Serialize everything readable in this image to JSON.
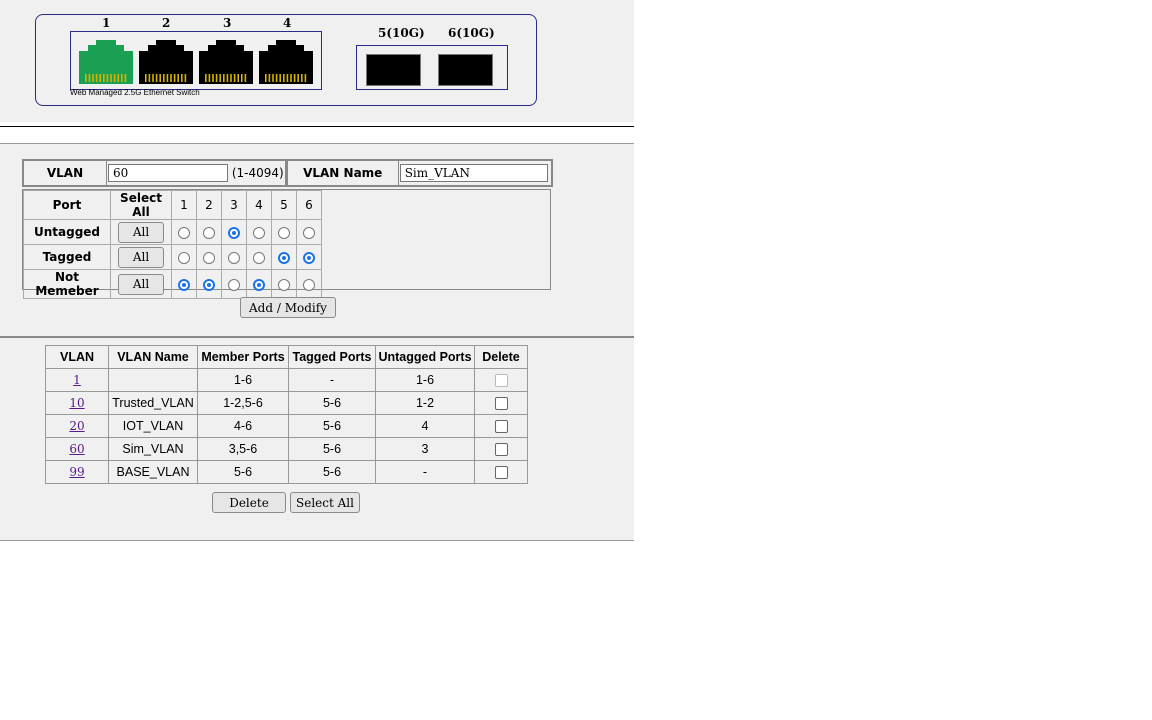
{
  "switch_panel": {
    "port_labels": [
      "1",
      "2",
      "3",
      "4",
      "5(10G)",
      "6(10G)"
    ],
    "caption": "Web Managed 2.5G Ethernet Switch",
    "port_status": [
      "link-up",
      "down",
      "down",
      "down",
      "down",
      "down"
    ],
    "colors": {
      "link_up": "#1aa052",
      "down": "#000000",
      "pins": "#d4b300"
    }
  },
  "vlan_form": {
    "vlan_label": "VLAN",
    "vlan_value": "60",
    "vlan_range": "(1-4094)",
    "vlan_name_label": "VLAN Name",
    "vlan_name_value": "Sim_VLAN"
  },
  "port_table": {
    "header": {
      "port": "Port",
      "select_all": "Select All",
      "ports": [
        "1",
        "2",
        "3",
        "4",
        "5",
        "6"
      ]
    },
    "rows": [
      {
        "label": "Untagged",
        "button": "All",
        "selected": [
          false,
          false,
          true,
          false,
          false,
          false
        ]
      },
      {
        "label": "Tagged",
        "button": "All",
        "selected": [
          false,
          false,
          false,
          false,
          true,
          true
        ]
      },
      {
        "label": "Not Memeber",
        "button": "All",
        "selected": [
          true,
          true,
          false,
          true,
          false,
          false
        ]
      }
    ],
    "add_modify_label": "Add / Modify"
  },
  "vlan_list": {
    "headers": [
      "VLAN",
      "VLAN Name",
      "Member Ports",
      "Tagged Ports",
      "Untagged Ports",
      "Delete"
    ],
    "rows": [
      {
        "vlan": "1",
        "name": "",
        "member": "1-6",
        "tagged": "-",
        "untagged": "1-6",
        "delete_disabled": true
      },
      {
        "vlan": "10",
        "name": "Trusted_VLAN",
        "member": "1-2,5-6",
        "tagged": "5-6",
        "untagged": "1-2",
        "delete_disabled": false
      },
      {
        "vlan": "20",
        "name": "IOT_VLAN",
        "member": "4-6",
        "tagged": "5-6",
        "untagged": "4",
        "delete_disabled": false
      },
      {
        "vlan": "60",
        "name": "Sim_VLAN",
        "member": "3,5-6",
        "tagged": "5-6",
        "untagged": "3",
        "delete_disabled": false
      },
      {
        "vlan": "99",
        "name": "BASE_VLAN",
        "member": "5-6",
        "tagged": "5-6",
        "untagged": "-",
        "delete_disabled": false
      }
    ],
    "delete_label": "Delete",
    "select_all_label": "Select All"
  },
  "accent_color": "#1a73e8"
}
